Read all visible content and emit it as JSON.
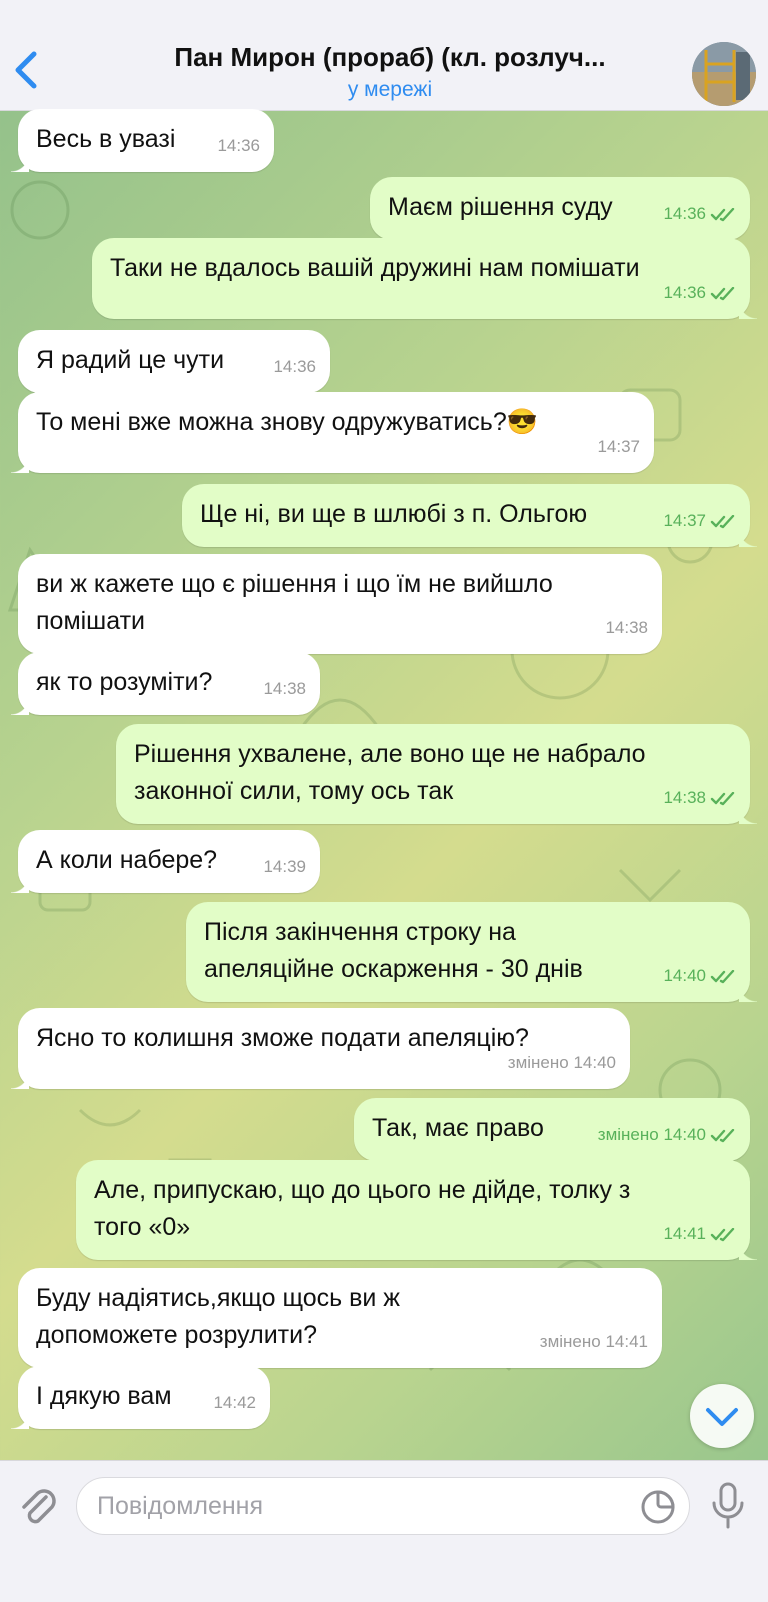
{
  "header": {
    "title": "Пан Мирон (прораб) (кл. розлуч...",
    "status": "у мережі",
    "accent_color": "#2f8cf0"
  },
  "messages": [
    {
      "dir": "in",
      "text": "Весь в увазі",
      "time": "14:36"
    },
    {
      "dir": "out",
      "text": "Маєм рішення суду",
      "time": "14:36"
    },
    {
      "dir": "out",
      "text": "Таки не вдалось вашій дружині нам помішати",
      "time": "14:36"
    },
    {
      "dir": "in",
      "text": "Я радий це чути",
      "time": "14:36"
    },
    {
      "dir": "in",
      "text": "То мені вже можна знову одружуватись?😎",
      "time": "14:37"
    },
    {
      "dir": "out",
      "text": "Ще ні, ви ще в шлюбі з п. Ольгою",
      "time": "14:37"
    },
    {
      "dir": "in",
      "text": "ви ж кажете що є рішення і що їм не вийшло помішати",
      "time": "14:38"
    },
    {
      "dir": "in",
      "text": "як то розуміти?",
      "time": "14:38"
    },
    {
      "dir": "out",
      "text": "Рішення ухвалене, але воно ще не набрало законної сили, тому ось так",
      "time": "14:38"
    },
    {
      "dir": "in",
      "text": "А коли набере?",
      "time": "14:39"
    },
    {
      "dir": "out",
      "text": "Після закінчення строку на апеляційне оскарження - 30 днів",
      "time": "14:40"
    },
    {
      "dir": "in",
      "text": "Ясно то колишня зможе подати апеляцію?",
      "time": "змінено 14:40"
    },
    {
      "dir": "out",
      "text": "Так, має право",
      "time": "змінено 14:40"
    },
    {
      "dir": "out",
      "text": "Але, припускаю, що до цього не дійде, толку з того «0»",
      "time": "14:41"
    },
    {
      "dir": "in",
      "text": "Буду надіятись,якщо щось ви ж допоможете розрулити?",
      "time": "змінено 14:41"
    },
    {
      "dir": "in",
      "text": "І дякую вам",
      "time": "14:42"
    }
  ],
  "composer": {
    "placeholder": "Повідомлення"
  },
  "colors": {
    "incoming_bubble": "#ffffff",
    "outgoing_bubble": "#e2fdc7",
    "read_check": "#58b15a"
  },
  "icons": [
    "back-chevron-icon",
    "avatar",
    "double-check-icon",
    "scroll-down-icon",
    "attach-icon",
    "sticker-icon",
    "mic-icon"
  ]
}
